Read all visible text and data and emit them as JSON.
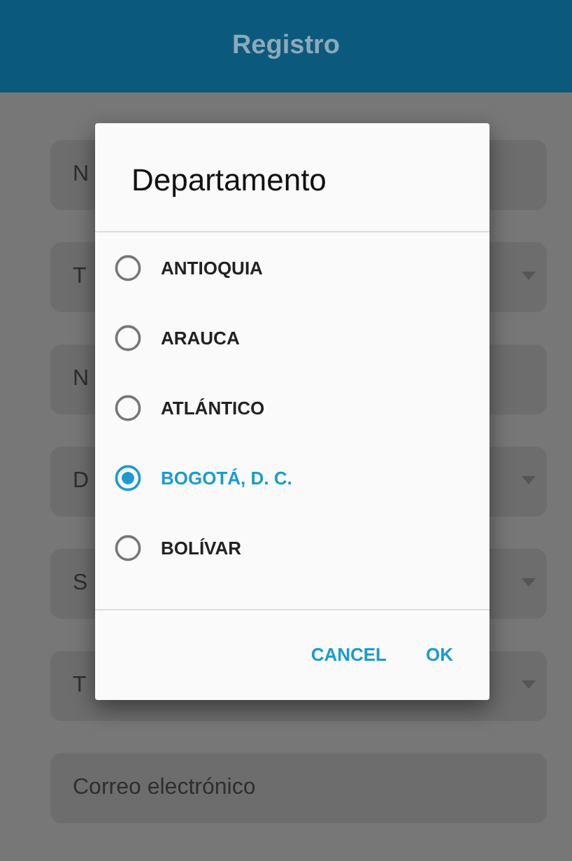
{
  "app_bar": {
    "title": "Registro"
  },
  "form_fields": [
    {
      "kind": "text",
      "placeholder": "N"
    },
    {
      "kind": "dropdown",
      "placeholder": "T"
    },
    {
      "kind": "text",
      "placeholder": "N"
    },
    {
      "kind": "dropdown",
      "placeholder": "D"
    },
    {
      "kind": "dropdown",
      "placeholder": "S"
    },
    {
      "kind": "dropdown",
      "placeholder": "T"
    },
    {
      "kind": "text",
      "placeholder": "Correo electrónico"
    }
  ],
  "dialog": {
    "title": "Departamento",
    "options": [
      {
        "label": "ANTIOQUIA",
        "selected": false
      },
      {
        "label": "ARAUCA",
        "selected": false
      },
      {
        "label": "ATLÁNTICO",
        "selected": false
      },
      {
        "label": "BOGOTÁ, D. C.",
        "selected": true
      },
      {
        "label": "BOLÍVAR",
        "selected": false
      }
    ],
    "buttons": [
      "CANCEL",
      "OK"
    ]
  }
}
